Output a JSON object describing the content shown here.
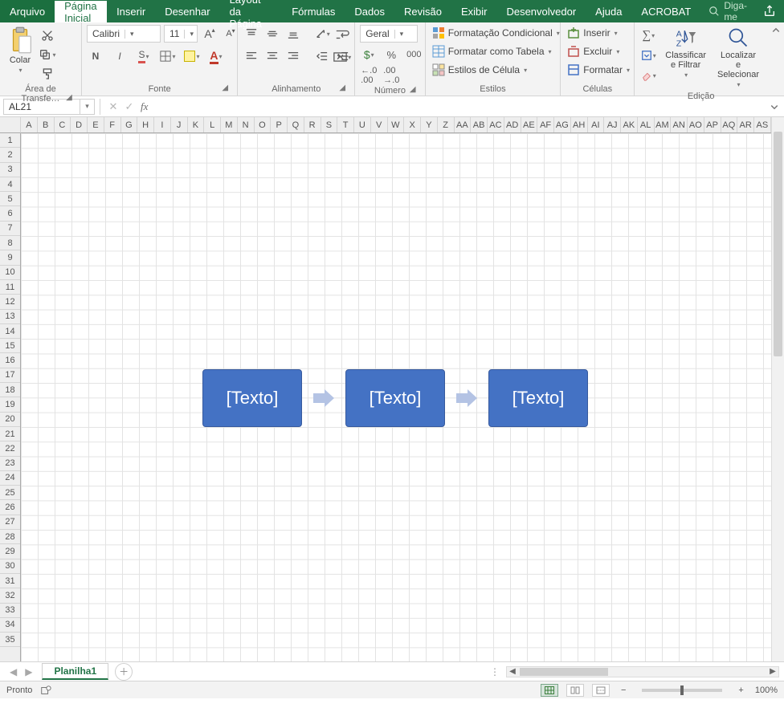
{
  "tabs": {
    "arquivo": "Arquivo",
    "pagina_inicial": "Página Inicial",
    "inserir": "Inserir",
    "desenhar": "Desenhar",
    "layout": "Layout da Página",
    "formulas": "Fórmulas",
    "dados": "Dados",
    "revisao": "Revisão",
    "exibir": "Exibir",
    "desenvolvedor": "Desenvolvedor",
    "ajuda": "Ajuda",
    "acrobat": "ACROBAT",
    "tellme": "Diga-me"
  },
  "ribbon": {
    "clipboard": {
      "colar": "Colar",
      "group": "Área de Transfe…"
    },
    "fonte": {
      "group": "Fonte",
      "font_name": "Calibri",
      "font_size": "11",
      "bold": "N",
      "italic": "I",
      "underline": "S"
    },
    "alinhamento": {
      "group": "Alinhamento"
    },
    "numero": {
      "group": "Número",
      "format": "Geral"
    },
    "estilos": {
      "group": "Estilos",
      "condicional": "Formatação Condicional",
      "tabela": "Formatar como Tabela",
      "celula": "Estilos de Célula"
    },
    "celulas": {
      "group": "Células",
      "inserir": "Inserir",
      "excluir": "Excluir",
      "formatar": "Formatar"
    },
    "edicao": {
      "group": "Edição",
      "classificar": "Classificar\ne Filtrar",
      "localizar": "Localizar e\nSelecionar"
    }
  },
  "namebox": "AL21",
  "columns": [
    "A",
    "B",
    "C",
    "D",
    "E",
    "F",
    "G",
    "H",
    "I",
    "J",
    "K",
    "L",
    "M",
    "N",
    "O",
    "P",
    "Q",
    "R",
    "S",
    "T",
    "U",
    "V",
    "W",
    "X",
    "Y",
    "Z",
    "AA",
    "AB",
    "AC",
    "AD",
    "AE",
    "AF",
    "AG",
    "AH",
    "AI",
    "AJ",
    "AK",
    "AL",
    "AM",
    "AN",
    "AO",
    "AP",
    "AQ",
    "AR",
    "AS"
  ],
  "row_count": 35,
  "smartart": {
    "t1": "[Texto]",
    "t2": "[Texto]",
    "t3": "[Texto]"
  },
  "sheet": {
    "name": "Planilha1"
  },
  "status": {
    "pronto": "Pronto",
    "zoom": "100%"
  }
}
